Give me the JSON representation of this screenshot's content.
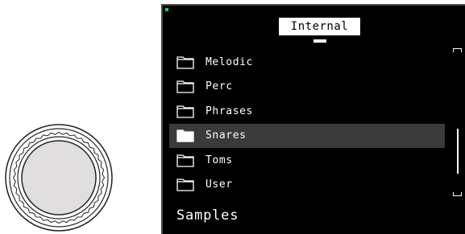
{
  "header": {
    "location_label": "Internal"
  },
  "browser": {
    "items": [
      {
        "label": "Melodic",
        "icon": "folder-icon",
        "selected": false
      },
      {
        "label": "Perc",
        "icon": "folder-icon",
        "selected": false
      },
      {
        "label": "Phrases",
        "icon": "folder-icon",
        "selected": false
      },
      {
        "label": "Snares",
        "icon": "folder-open-icon",
        "selected": true
      },
      {
        "label": "Toms",
        "icon": "folder-icon",
        "selected": false
      },
      {
        "label": "User",
        "icon": "folder-icon",
        "selected": false
      }
    ]
  },
  "footer": {
    "category_label": "Samples"
  },
  "colors": {
    "screen_bg": "#000000",
    "text": "#ffffff",
    "selection": "#3a3a3a",
    "led": "#21d05a"
  }
}
